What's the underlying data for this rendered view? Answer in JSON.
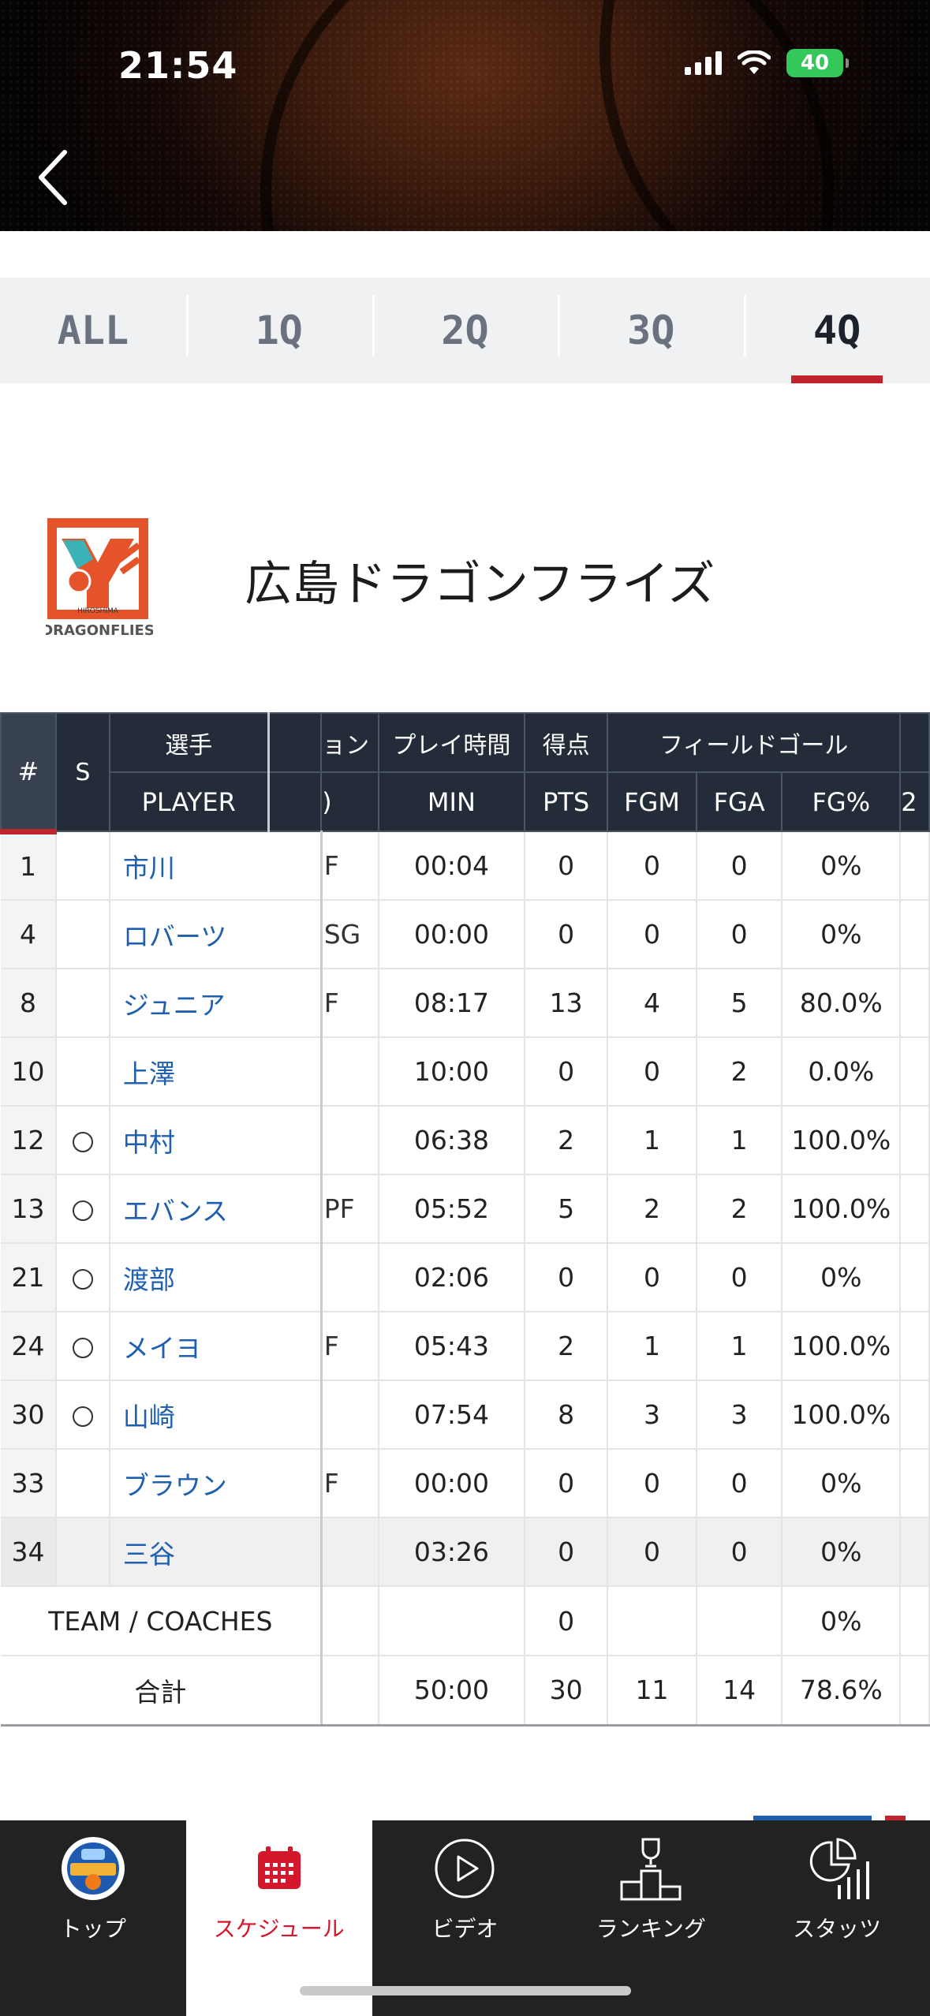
{
  "status_bar": {
    "time": "21:54",
    "battery": "40"
  },
  "tabs": [
    {
      "label": "ALL",
      "active": false
    },
    {
      "label": "1Q",
      "active": false
    },
    {
      "label": "2Q",
      "active": false
    },
    {
      "label": "3Q",
      "active": false
    },
    {
      "label": "4Q",
      "active": true
    }
  ],
  "team": {
    "name": "広島ドラゴンフライズ",
    "logo_text_top": "HIROSHIMA",
    "logo_text_bottom": "DRAGONFLIES"
  },
  "table": {
    "header_top": {
      "player": "選手",
      "position": "ョン",
      "min": "プレイ時間",
      "pts": "得点",
      "fg": "フィールドゴール"
    },
    "header_bottom": {
      "num": "#",
      "starter": "S",
      "player": "PLAYER",
      "position": ")",
      "min": "MIN",
      "pts": "PTS",
      "fgm": "FGM",
      "fga": "FGA",
      "fgpct": "FG%",
      "next": "2"
    },
    "rows": [
      {
        "num": "1",
        "starter": false,
        "name": "市川",
        "pos": "F",
        "min": "00:04",
        "pts": "0",
        "fgm": "0",
        "fga": "0",
        "fgpct": "0%"
      },
      {
        "num": "4",
        "starter": false,
        "name": "ロバーツ",
        "pos": "SG",
        "min": "00:00",
        "pts": "0",
        "fgm": "0",
        "fga": "0",
        "fgpct": "0%"
      },
      {
        "num": "8",
        "starter": false,
        "name": "ジュニア",
        "pos": "F",
        "min": "08:17",
        "pts": "13",
        "fgm": "4",
        "fga": "5",
        "fgpct": "80.0%"
      },
      {
        "num": "10",
        "starter": false,
        "name": "上澤",
        "pos": "",
        "min": "10:00",
        "pts": "0",
        "fgm": "0",
        "fga": "2",
        "fgpct": "0.0%"
      },
      {
        "num": "12",
        "starter": true,
        "name": "中村",
        "pos": "",
        "min": "06:38",
        "pts": "2",
        "fgm": "1",
        "fga": "1",
        "fgpct": "100.0%"
      },
      {
        "num": "13",
        "starter": true,
        "name": "エバンス",
        "pos": "PF",
        "min": "05:52",
        "pts": "5",
        "fgm": "2",
        "fga": "2",
        "fgpct": "100.0%"
      },
      {
        "num": "21",
        "starter": true,
        "name": "渡部",
        "pos": "",
        "min": "02:06",
        "pts": "0",
        "fgm": "0",
        "fga": "0",
        "fgpct": "0%"
      },
      {
        "num": "24",
        "starter": true,
        "name": "メイヨ",
        "pos": "F",
        "min": "05:43",
        "pts": "2",
        "fgm": "1",
        "fga": "1",
        "fgpct": "100.0%"
      },
      {
        "num": "30",
        "starter": true,
        "name": "山崎",
        "pos": "",
        "min": "07:54",
        "pts": "8",
        "fgm": "3",
        "fga": "3",
        "fgpct": "100.0%"
      },
      {
        "num": "33",
        "starter": false,
        "name": "ブラウン",
        "pos": "F",
        "min": "00:00",
        "pts": "0",
        "fgm": "0",
        "fga": "0",
        "fgpct": "0%"
      },
      {
        "num": "34",
        "starter": false,
        "name": "三谷",
        "pos": "",
        "min": "03:26",
        "pts": "0",
        "fgm": "0",
        "fga": "0",
        "fgpct": "0%"
      }
    ],
    "team_row": {
      "label": "TEAM / COACHES",
      "pts": "0",
      "fgpct": "0%"
    },
    "total_row": {
      "label": "合計",
      "min": "50:00",
      "pts": "30",
      "fgm": "11",
      "fga": "14",
      "fgpct": "78.6%"
    }
  },
  "bottom_nav": [
    {
      "label": "トップ",
      "icon": "robots-logo-icon",
      "active": false
    },
    {
      "label": "スケジュール",
      "icon": "calendar-icon",
      "active": true
    },
    {
      "label": "ビデオ",
      "icon": "play-icon",
      "active": false
    },
    {
      "label": "ランキング",
      "icon": "podium-icon",
      "active": false
    },
    {
      "label": "スタッツ",
      "icon": "stats-icon",
      "active": false
    }
  ],
  "colors": {
    "accent_red": "#c0242c",
    "header_navy": "#232c38",
    "link_blue": "#1f5fb0",
    "nav_active_red": "#d5172b",
    "battery_green": "#34c759"
  }
}
